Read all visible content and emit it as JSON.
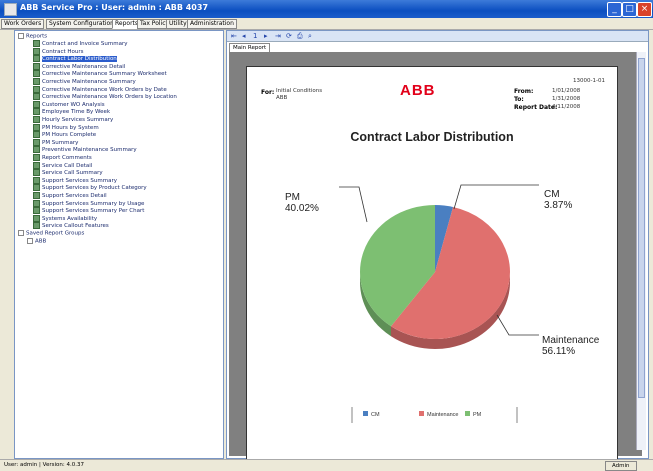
{
  "window": {
    "title": "ABB Service Pro : User: admin : ABB 4037",
    "minimize": "_",
    "maximize": "□",
    "close": "×"
  },
  "menu": {
    "tabs": [
      {
        "label": "Work Orders"
      },
      {
        "label": "System Configuration"
      },
      {
        "label": "Reports"
      },
      {
        "label": "Tax Policy"
      },
      {
        "label": "Utility"
      },
      {
        "label": "Administration"
      }
    ]
  },
  "tree": {
    "root_label": "Reports",
    "items": [
      "Contract and Invoice Summary",
      "Contract Hours",
      "Contract Labor Distribution",
      "Corrective Maintenance Detail",
      "Corrective Maintenance Summary Worksheet",
      "Corrective Maintenance Summary",
      "Corrective Maintenance Work Orders by Date",
      "Corrective Maintenance Work Orders by Location",
      "Customer WO Analysis",
      "Employee Time By Week",
      "Hourly Services Summary",
      "PM Hours by System",
      "PM Hours Complete",
      "PM Summary",
      "Preventive Maintenance Summary",
      "Report Comments",
      "Service Call Detail",
      "Service Call Summary",
      "Support Services Summary",
      "Support Services by Product Category",
      "Support Services Detail",
      "Support Services Summary by Usage",
      "Support Services Summary Per Chart",
      "Systems Availability",
      "Service Callout Features"
    ],
    "selected_index": 2,
    "group2_label": "Saved Report Groups",
    "group2_items": [
      "ABB"
    ]
  },
  "viewer": {
    "toolbar_icons": [
      "first-page-icon",
      "prev-page-icon",
      "page-number",
      "next-page-icon",
      "last-page-icon",
      "refresh-icon",
      "print-icon",
      "zoom-icon"
    ],
    "toolbar_glyphs": [
      "⇤",
      "◂",
      "1",
      "▸",
      "⇥",
      "⟳",
      "⎙",
      "⌕"
    ],
    "doc_tab": "Main Report",
    "report": {
      "page_id": "13000-1-01",
      "for_label": "For:",
      "for_value_1": "Initial Conditions",
      "for_value_2": "ABB",
      "logo": "ABB",
      "from_label": "From:",
      "from_value": "1/01/2008",
      "to_label": "To:",
      "to_value": "1/31/2008",
      "date_label": "Report Date:",
      "date_value": "4/11/2008"
    }
  },
  "status": {
    "left": "User: admin | Version: 4.0.37",
    "right": "Admin"
  },
  "chart_data": {
    "type": "pie",
    "title": "Contract Labor Distribution",
    "categories": [
      "CM",
      "Maintenance",
      "PM"
    ],
    "values": [
      3.87,
      56.11,
      40.02
    ],
    "labels": [
      "3.87%",
      "56.11%",
      "40.02%"
    ],
    "colors": [
      "#4a7fc1",
      "#e0706e",
      "#7dbf72"
    ],
    "legend": [
      "CM",
      "Maintenance",
      "PM"
    ],
    "legend_position": "bottom"
  }
}
